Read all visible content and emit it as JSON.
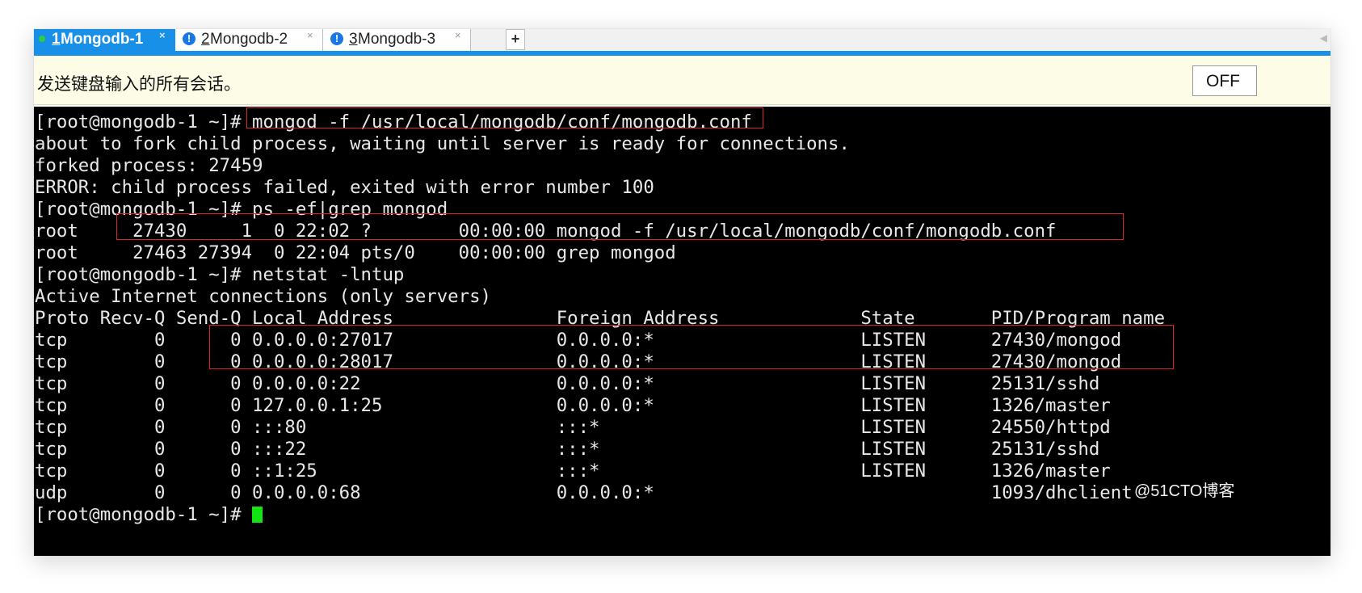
{
  "tabs": [
    {
      "num": "1",
      "name": " Mongodb-1",
      "close": "×"
    },
    {
      "num": "2",
      "name": " Mongodb-2",
      "close": "×"
    },
    {
      "num": "3",
      "name": " Mongodb-3",
      "close": "×"
    }
  ],
  "new_tab": "+",
  "send_bar": {
    "message": "发送键盘输入的所有会话。",
    "toggle": "OFF"
  },
  "terminal": {
    "lines": [
      [
        {
          "t": "[root@mongodb-1 ~]# "
        },
        {
          "t": "mongod -f /usr/local/mongodb/conf/mongodb.conf"
        }
      ],
      [
        {
          "t": "about to fork child process, waiting until server is ready for connections."
        }
      ],
      [
        {
          "t": "forked process: 27459"
        }
      ],
      [
        {
          "t": "ERROR: child process failed, exited with error number 100"
        }
      ],
      [
        {
          "t": "[root@mongodb-1 ~]# ps -ef|grep mongod"
        }
      ],
      [
        {
          "t": "root     27430     1  0 22:02 ?        00:00:00 mongod -f /usr/local/mongodb/conf/mongodb.conf"
        }
      ],
      [
        {
          "t": "root     27463 27394  0 22:04 pts/0    00:00:00 grep mongod"
        }
      ],
      [
        {
          "t": "[root@mongodb-1 ~]# netstat -lntup"
        }
      ],
      [
        {
          "t": "Active Internet connections (only servers)"
        }
      ],
      [
        {
          "t": "Proto Recv-Q Send-Q Local Address               Foreign Address             State       PID/Program name"
        }
      ],
      [
        {
          "t": "tcp        0      0 0.0.0.0:27017               0.0.0.0:*                   LISTEN      27430/mongod"
        }
      ],
      [
        {
          "t": "tcp        0      0 0.0.0.0:28017               0.0.0.0:*                   LISTEN      27430/mongod"
        }
      ],
      [
        {
          "t": "tcp        0      0 0.0.0.0:22                  0.0.0.0:*                   LISTEN      25131/sshd"
        }
      ],
      [
        {
          "t": "tcp        0      0 127.0.0.1:25                0.0.0.0:*                   LISTEN      1326/master"
        }
      ],
      [
        {
          "t": "tcp        0      0 :::80                       :::*                        LISTEN      24550/httpd"
        }
      ],
      [
        {
          "t": "tcp        0      0 :::22                       :::*                        LISTEN      25131/sshd"
        }
      ],
      [
        {
          "t": "tcp        0      0 ::1:25                      :::*                        LISTEN      1326/master"
        }
      ],
      [
        {
          "t": "udp        0      0 0.0.0.0:68                  0.0.0.0:*                               1093/dhclient"
        }
      ],
      [
        {
          "t": "[root@mongodb-1 ~]# "
        },
        {
          "cursor": true
        }
      ]
    ]
  },
  "watermark": "@51CTO博客",
  "colors": {
    "active_tab": "#1890e8",
    "terminal_bg": "#000000",
    "terminal_fg": "#e8e8e8",
    "highlight_box": "#e0222a",
    "cursor": "#12e612",
    "send_bar_bg": "#fdfce6",
    "status_dot": "#2ecc40",
    "warning_icon": "#1a78e6"
  }
}
